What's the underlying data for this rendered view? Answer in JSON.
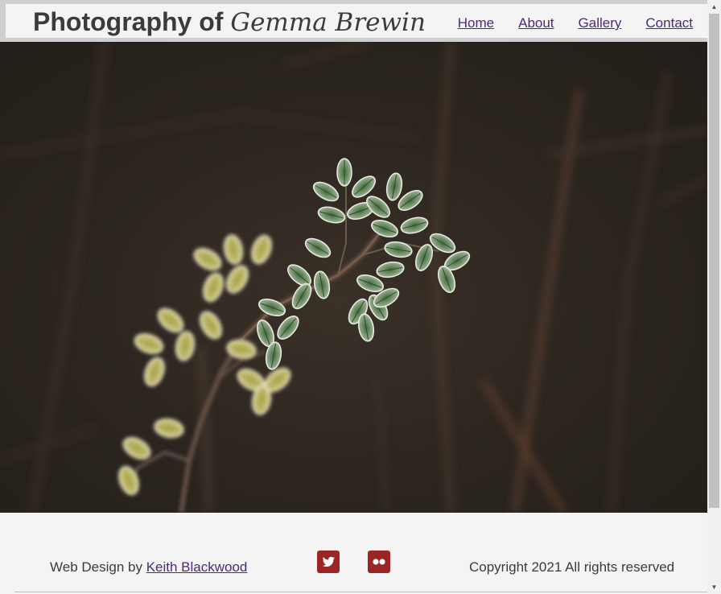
{
  "header": {
    "title_plain": "Photography of",
    "title_script": "Gemma Brewin",
    "nav": [
      {
        "label": "Home"
      },
      {
        "label": "About"
      },
      {
        "label": "Gallery"
      },
      {
        "label": "Contact"
      }
    ]
  },
  "hero": {
    "alt": "Frost covered rose leaves"
  },
  "footer": {
    "credit_prefix": "Web Design by",
    "credit_link": "Keith Blackwood",
    "social": [
      {
        "icon": "twitter-icon"
      },
      {
        "icon": "flickr-icon"
      }
    ],
    "copyright": "Copyright 2021 All rights reserved"
  },
  "colors": {
    "link": "#4b2a7a",
    "title": "#383c3f",
    "social_bg": "#9b2424",
    "header_border": "#cfcfcf",
    "page_bg": "#f4f4f4"
  },
  "scrollbar": {
    "up_glyph": "▲",
    "down_glyph": "▼"
  }
}
